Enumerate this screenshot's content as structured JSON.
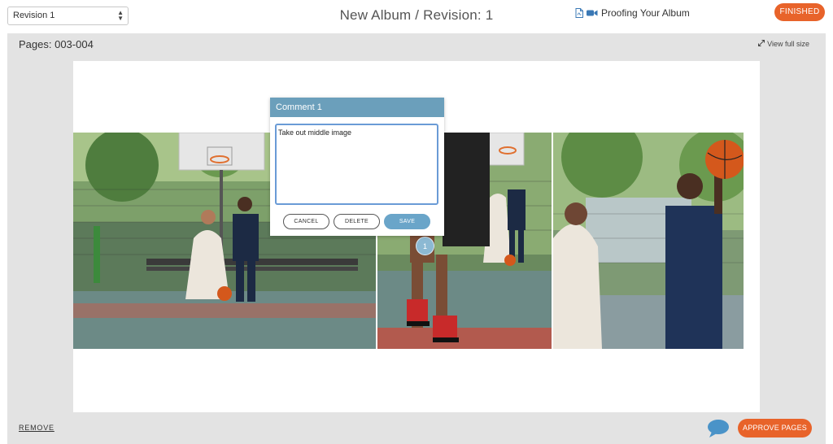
{
  "header": {
    "revision_select": "Revision 1",
    "title": "New Album / Revision: 1",
    "proof_label": "Proofing Your Album",
    "finished_label": "FINISHED"
  },
  "workspace": {
    "pages_label": "Pages: 003-004",
    "view_full_size": "View full size"
  },
  "comment": {
    "title": "Comment 1",
    "text": "Take out middle image",
    "cancel": "CANCEL",
    "delete": "DELETE",
    "save": "SAVE",
    "marker_number": "1"
  },
  "footer": {
    "remove": "REMOVE",
    "approve": "APPROVE PAGES"
  },
  "icons": {
    "pdf": "pdf-icon",
    "video": "video-camera-icon",
    "expand": "expand-icon",
    "chat": "chat-bubble-icon"
  },
  "colors": {
    "accent_orange": "#e8632a",
    "comment_blue": "#6b9fbb",
    "save_blue": "#6aa5c9",
    "workspace_gray": "#e3e3e3"
  }
}
